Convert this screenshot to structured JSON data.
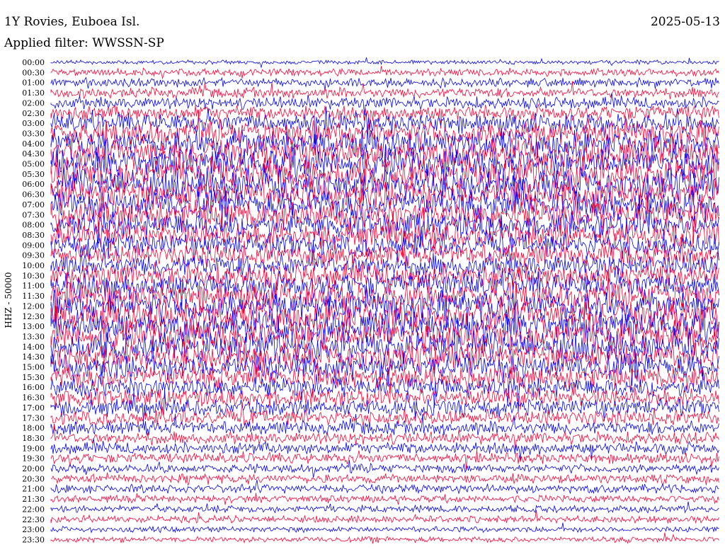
{
  "header": {
    "station": "1Y Rovies, Euboea Isl.",
    "date": "2025-05-13",
    "filter_text": "Applied filter: WWSSN-SP"
  },
  "axis": {
    "channel_label": "HHZ - 50000"
  },
  "trace_colors": [
    "#0000ff",
    "#ff0033"
  ],
  "rows": [
    {
      "time": "00:00",
      "level": 0.05
    },
    {
      "time": "00:30",
      "level": 0.15
    },
    {
      "time": "01:00",
      "level": 0.2
    },
    {
      "time": "01:30",
      "level": 0.25
    },
    {
      "time": "02:00",
      "level": 0.3
    },
    {
      "time": "02:30",
      "level": 0.4
    },
    {
      "time": "03:00",
      "level": 0.55
    },
    {
      "time": "03:30",
      "level": 0.7
    },
    {
      "time": "04:00",
      "level": 0.8
    },
    {
      "time": "04:30",
      "level": 0.85
    },
    {
      "time": "05:00",
      "level": 0.9
    },
    {
      "time": "05:30",
      "level": 0.9
    },
    {
      "time": "06:00",
      "level": 0.9
    },
    {
      "time": "06:30",
      "level": 0.85
    },
    {
      "time": "07:00",
      "level": 0.85
    },
    {
      "time": "07:30",
      "level": 0.8
    },
    {
      "time": "08:00",
      "level": 0.75
    },
    {
      "time": "08:30",
      "level": 0.7
    },
    {
      "time": "09:00",
      "level": 0.65
    },
    {
      "time": "09:30",
      "level": 0.6
    },
    {
      "time": "10:00",
      "level": 0.65
    },
    {
      "time": "10:30",
      "level": 0.7
    },
    {
      "time": "11:00",
      "level": 0.75
    },
    {
      "time": "11:30",
      "level": 0.8
    },
    {
      "time": "12:00",
      "level": 0.85
    },
    {
      "time": "12:30",
      "level": 0.9
    },
    {
      "time": "13:00",
      "level": 0.9
    },
    {
      "time": "13:30",
      "level": 0.9
    },
    {
      "time": "14:00",
      "level": 0.85
    },
    {
      "time": "14:30",
      "level": 0.8
    },
    {
      "time": "15:00",
      "level": 0.75
    },
    {
      "time": "15:30",
      "level": 0.65
    },
    {
      "time": "16:00",
      "level": 0.55
    },
    {
      "time": "16:30",
      "level": 0.5
    },
    {
      "time": "17:00",
      "level": 0.45
    },
    {
      "time": "17:30",
      "level": 0.4
    },
    {
      "time": "18:00",
      "level": 0.35
    },
    {
      "time": "18:30",
      "level": 0.3
    },
    {
      "time": "19:00",
      "level": 0.3
    },
    {
      "time": "19:30",
      "level": 0.25
    },
    {
      "time": "20:00",
      "level": 0.2
    },
    {
      "time": "20:30",
      "level": 0.2
    },
    {
      "time": "21:00",
      "level": 0.2
    },
    {
      "time": "21:30",
      "level": 0.15
    },
    {
      "time": "22:00",
      "level": 0.15
    },
    {
      "time": "22:30",
      "level": 0.15
    },
    {
      "time": "23:00",
      "level": 0.1
    },
    {
      "time": "23:30",
      "level": 0.1
    }
  ]
}
